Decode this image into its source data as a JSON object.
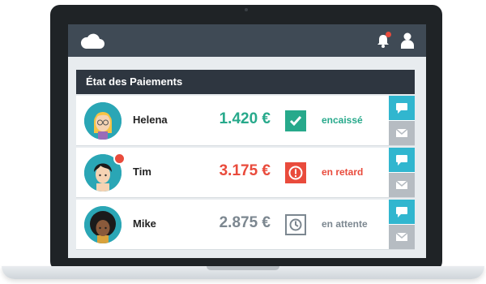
{
  "panel": {
    "title": "État des Paiements"
  },
  "colors": {
    "paid": "#27a98b",
    "late": "#e94b3c",
    "pending": "#7c8790",
    "accent": "#31b6cf",
    "topbar": "#3f4a55"
  },
  "rows": [
    {
      "name": "Helena",
      "amount": "1.420 €",
      "status": "encaissé",
      "status_icon": "check-icon"
    },
    {
      "name": "Tim",
      "amount": "3.175 €",
      "status": "en retard",
      "status_icon": "alert-icon"
    },
    {
      "name": "Mike",
      "amount": "2.875 €",
      "status": "en attente",
      "status_icon": "clock-icon"
    }
  ]
}
